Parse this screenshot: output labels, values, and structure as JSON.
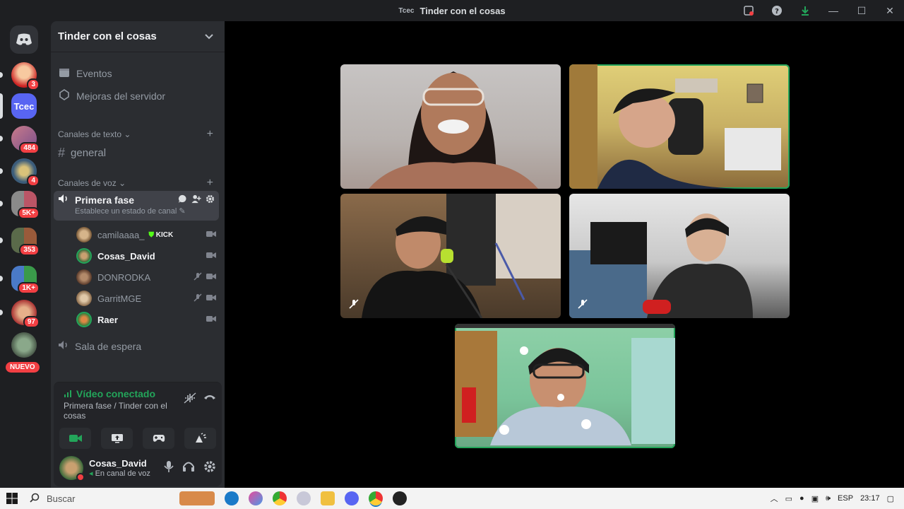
{
  "window": {
    "app_icon_text": "Tcec",
    "title": "Tinder con el cosas"
  },
  "rail": {
    "servers": [
      {
        "badge": "3"
      },
      {
        "badge": "",
        "label": "Tcec",
        "active": true
      },
      {
        "badge": "484"
      },
      {
        "badge": "4"
      },
      {
        "badge": "5K+"
      },
      {
        "badge": "353"
      },
      {
        "badge": "1K+"
      },
      {
        "badge": "97"
      },
      {
        "badge": ""
      }
    ],
    "new_label": "NUEVO"
  },
  "sidebar": {
    "server_name": "Tinder con el cosas",
    "events_label": "Eventos",
    "boosts_label": "Mejoras del servidor",
    "text_category": "Canales de texto",
    "general_channel": "general",
    "voice_category": "Canales de voz",
    "active_voice": {
      "name": "Primera fase",
      "status": "Establece un estado de canal"
    },
    "members": [
      {
        "name": "camilaaaa_",
        "badge": "KICK",
        "bold": false,
        "muted": false
      },
      {
        "name": "Cosas_David",
        "badge": "",
        "bold": true,
        "muted": false
      },
      {
        "name": "DONRODKA",
        "badge": "",
        "bold": false,
        "muted": true
      },
      {
        "name": "GarritMGE",
        "badge": "",
        "bold": false,
        "muted": true
      },
      {
        "name": "Raer",
        "badge": "",
        "bold": true,
        "muted": false
      }
    ],
    "waiting_room": "Sala de espera"
  },
  "voice_panel": {
    "title": "Vídeo conectado",
    "subtitle": "Primera fase / Tinder con el cosas"
  },
  "user_panel": {
    "username": "Cosas_David",
    "status": "En canal de voz"
  },
  "taskbar": {
    "search_placeholder": "Buscar",
    "language": "ESP",
    "time": "23:17"
  },
  "colors": {
    "accent_green": "#23a55a",
    "badge_red": "#f23f43",
    "sidebar_bg": "#2b2d31",
    "rail_bg": "#1e1f22"
  }
}
